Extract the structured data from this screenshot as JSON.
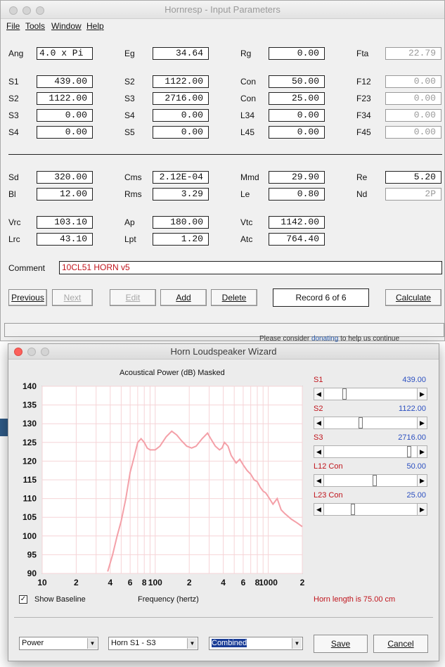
{
  "hornresp": {
    "title": "Hornresp - Input Parameters",
    "menu": [
      "File",
      "Tools",
      "Window",
      "Help"
    ],
    "row_ang": {
      "ang_label": "Ang",
      "ang": "4.0 x Pi",
      "eg_label": "Eg",
      "eg": "34.64",
      "rg_label": "Rg",
      "rg": "0.00",
      "fta_label": "Fta",
      "fta": "22.79"
    },
    "segments": [
      {
        "s_label": "S1",
        "s": "439.00",
        "t_label": "S2",
        "t": "1122.00",
        "c_label": "Con",
        "c": "50.00",
        "f_label": "F12",
        "f": "0.00"
      },
      {
        "s_label": "S2",
        "s": "1122.00",
        "t_label": "S3",
        "t": "2716.00",
        "c_label": "Con",
        "c": "25.00",
        "f_label": "F23",
        "f": "0.00"
      },
      {
        "s_label": "S3",
        "s": "0.00",
        "t_label": "S4",
        "t": "0.00",
        "c_label": "L34",
        "c": "0.00",
        "f_label": "F34",
        "f": "0.00"
      },
      {
        "s_label": "S4",
        "s": "0.00",
        "t_label": "S5",
        "t": "0.00",
        "c_label": "L45",
        "c": "0.00",
        "f_label": "F45",
        "f": "0.00"
      }
    ],
    "driver": [
      {
        "a_label": "Sd",
        "a": "320.00",
        "b_label": "Cms",
        "b": "2.12E-04",
        "c_label": "Mmd",
        "c": "29.90",
        "d_label": "Re",
        "d": "5.20"
      },
      {
        "a_label": "Bl",
        "a": "12.00",
        "b_label": "Rms",
        "b": "3.29",
        "c_label": "Le",
        "c": "0.80",
        "d_label": "Nd",
        "d": "2P"
      }
    ],
    "chambers": [
      {
        "a_label": "Vrc",
        "a": "103.10",
        "b_label": "Ap",
        "b": "180.00",
        "c_label": "Vtc",
        "c": "1142.00"
      },
      {
        "a_label": "Lrc",
        "a": "43.10",
        "b_label": "Lpt",
        "b": "1.20",
        "c_label": "Atc",
        "c": "764.40"
      }
    ],
    "comment_label": "Comment",
    "comment": "10CL51 HORN v5",
    "buttons": {
      "previous": "Previous",
      "next": "Next",
      "edit": "Edit",
      "add": "Add",
      "delete": "Delete",
      "calculate": "Calculate"
    },
    "record": "Record 6 of 6"
  },
  "background": {
    "notice_prefix": "Please consider ",
    "notice_link": "donating",
    "notice_suffix": " to help us continue"
  },
  "wizard": {
    "title": "Horn Loudspeaker Wizard",
    "chart_caption": "Acoustical Power (dB)   Masked",
    "sliders": [
      {
        "label": "S1",
        "value": "439.00",
        "pos": 0.2
      },
      {
        "label": "S2",
        "value": "1122.00",
        "pos": 0.39
      },
      {
        "label": "S3",
        "value": "2716.00",
        "pos": 0.94
      },
      {
        "label": "L12  Con",
        "value": "50.00",
        "pos": 0.55
      },
      {
        "label": "L23  Con",
        "value": "25.00",
        "pos": 0.3
      }
    ],
    "show_baseline_label": "Show Baseline",
    "show_baseline_checked": "✓",
    "x_caption": "Frequency (hertz)",
    "horn_length": "Horn length is 75.00 cm",
    "combos": {
      "type": "Power",
      "segment": "Horn S1 - S3",
      "mode": "Combined"
    },
    "save": "Save",
    "cancel": "Cancel"
  },
  "chart_data": {
    "type": "line",
    "title": "Acoustical Power (dB)   Masked",
    "xlabel": "Frequency (hertz)",
    "ylabel": "",
    "x_scale": "log",
    "xlim": [
      10,
      2000
    ],
    "ylim": [
      90,
      140
    ],
    "x_tick_labels": [
      "10",
      "2",
      "4",
      "6",
      "8",
      "100",
      "2",
      "4",
      "6",
      "8",
      "1000",
      "2"
    ],
    "y_tick_labels": [
      "140",
      "135",
      "130",
      "125",
      "120",
      "115",
      "110",
      "105",
      "100",
      "95",
      "90"
    ],
    "grid": true,
    "line_color": "#f4a0a8",
    "series": [
      {
        "x": [
          38,
          42,
          46,
          50,
          55,
          60,
          65,
          70,
          75,
          80,
          85,
          90,
          100,
          110,
          125,
          140,
          155,
          170,
          190,
          210,
          230,
          260,
          290,
          310,
          340,
          370,
          390,
          410,
          440,
          470,
          520,
          560,
          600,
          650,
          700,
          750,
          800,
          850,
          900,
          950,
          1000,
          1100,
          1200,
          1300,
          1400,
          1600,
          1800,
          2000
        ],
        "y": [
          90.5,
          95,
          100,
          104,
          110,
          117,
          121,
          125,
          126,
          125,
          123.5,
          123,
          123,
          124,
          126.5,
          128,
          127,
          125.5,
          124,
          123.5,
          124,
          126,
          127.5,
          126,
          124,
          123,
          123.5,
          125,
          124,
          121.5,
          119.5,
          120.5,
          119,
          117.5,
          116.5,
          115,
          114.5,
          113,
          112,
          111.5,
          110.5,
          108.5,
          110,
          107,
          106,
          104.5,
          103.5,
          102.5
        ]
      }
    ]
  }
}
